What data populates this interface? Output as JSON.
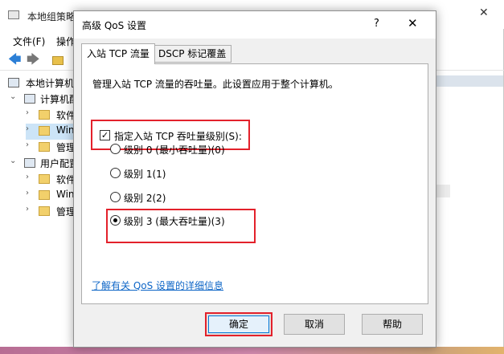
{
  "background_window": {
    "title": "本地组策略",
    "close_glyph": "✕",
    "menu": {
      "file": "文件(F)",
      "action": "操作"
    },
    "toolbar": {
      "back_glyph": "🡄",
      "forward_glyph": "🡆"
    },
    "tree": [
      {
        "label": "本地计算机",
        "arrow": ""
      },
      {
        "label": "计算机配",
        "arrow": "⌄"
      },
      {
        "label": "软件",
        "arrow": "›"
      },
      {
        "label": "Win",
        "arrow": "›"
      },
      {
        "label": "管理",
        "arrow": "›"
      },
      {
        "label": "用户配置",
        "arrow": "⌄"
      },
      {
        "label": "软件",
        "arrow": "›"
      },
      {
        "label": "Win",
        "arrow": "›"
      },
      {
        "label": "管理",
        "arrow": "›"
      }
    ]
  },
  "dialog": {
    "title": "高级 QoS 设置",
    "help_glyph": "?",
    "close_glyph": "✕",
    "tabs": [
      {
        "label": "入站 TCP 流量",
        "active": true
      },
      {
        "label": "DSCP 标记覆盖",
        "active": false
      }
    ],
    "description": "管理入站 TCP 流量的吞吐量。此设置应用于整个计算机。",
    "specify_checkbox": {
      "label": "指定入站 TCP 吞吐量级别(S):",
      "checked": true,
      "glyph": "✓"
    },
    "levels": [
      {
        "label": "级别 0 (最小吞吐量)(0)",
        "selected": false
      },
      {
        "label": "级别 1(1)",
        "selected": false
      },
      {
        "label": "级别 2(2)",
        "selected": false
      },
      {
        "label": "级别 3 (最大吞吐量)(3)",
        "selected": true
      }
    ],
    "details_link": "了解有关 QoS 设置的详细信息",
    "buttons": {
      "ok": "确定",
      "cancel": "取消",
      "help": "帮助"
    }
  },
  "colors": {
    "highlight_border": "#e3212b",
    "link": "#0e66c7",
    "focus_border": "#0078d7"
  }
}
